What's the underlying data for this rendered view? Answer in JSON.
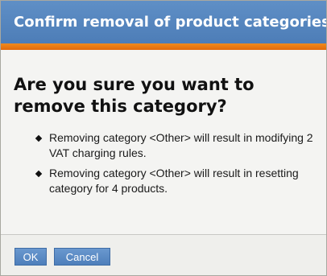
{
  "dialog": {
    "title": "Confirm removal of product categories",
    "heading": "Are you sure you want to remove this category?",
    "messages": [
      "Removing category <Other> will result in modifying 2 VAT charging rules.",
      "Removing category <Other> will result in resetting category for 4 products."
    ]
  },
  "buttons": {
    "ok_label": "OK",
    "cancel_label": "Cancel"
  },
  "colors": {
    "titlebar": "#5585c0",
    "accent_bar": "#e8770f",
    "button": "#5b8cc7"
  }
}
